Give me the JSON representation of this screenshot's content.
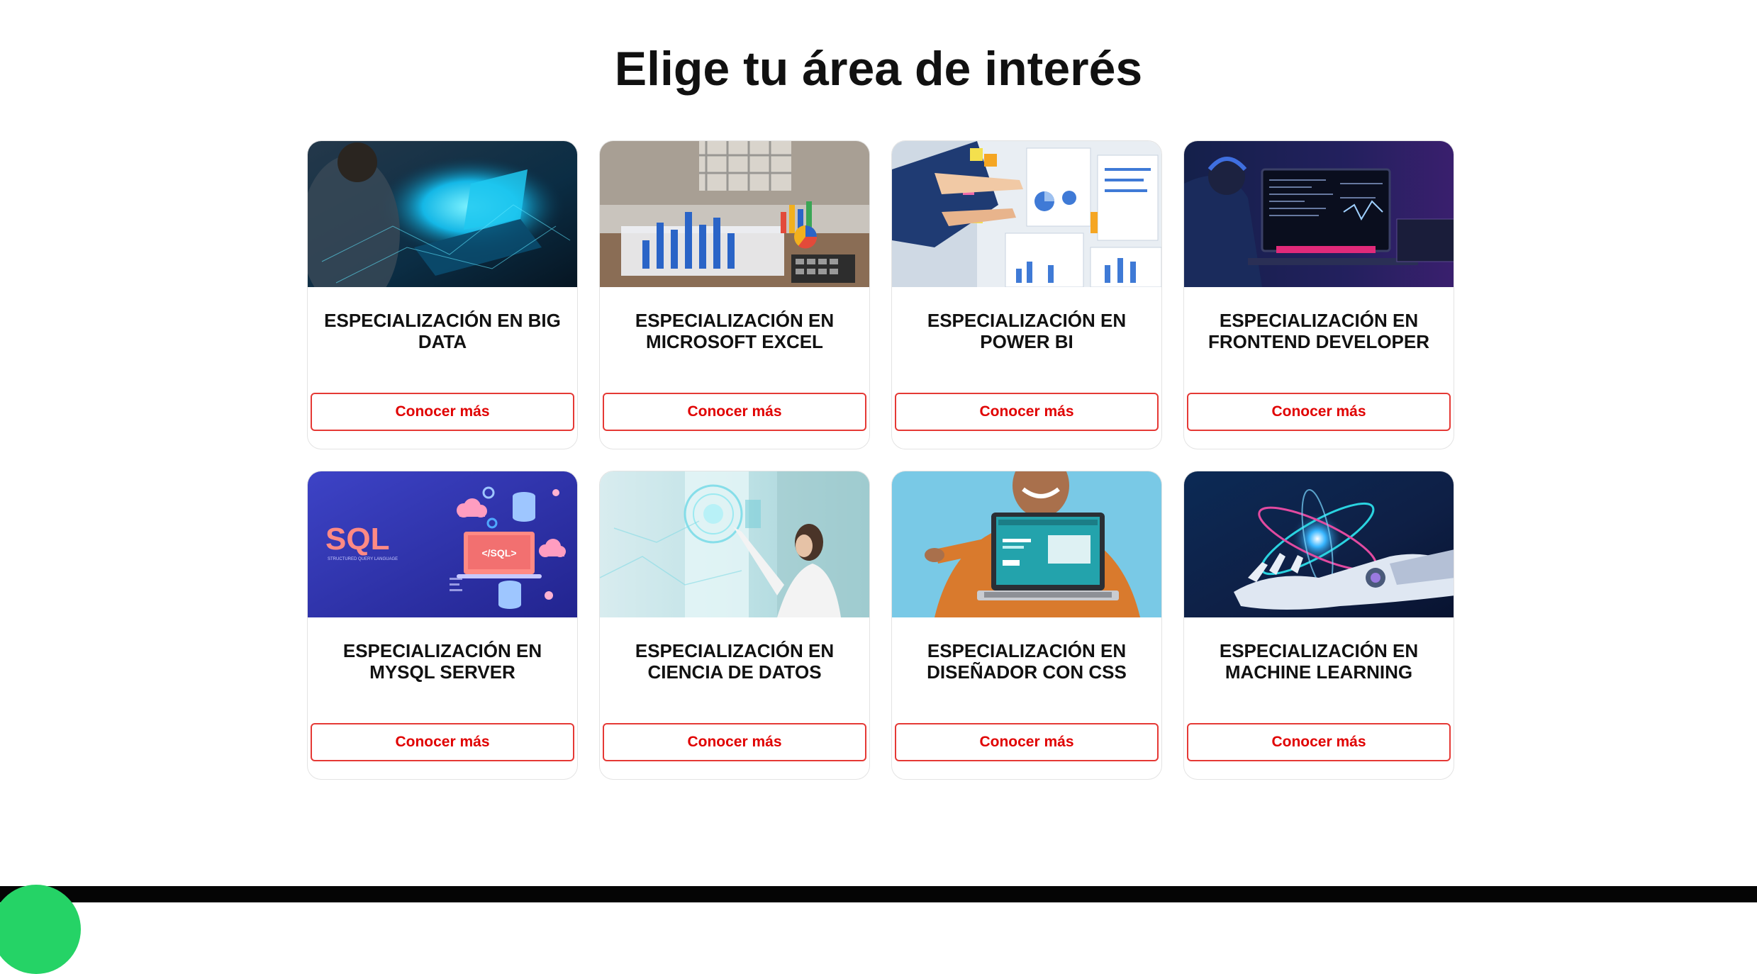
{
  "page": {
    "title": "Elige tu área de interés"
  },
  "cards": [
    {
      "title": "ESPECIALIZACIÓN EN BIG DATA",
      "button": "Conocer más",
      "image": "person-laptop-glowing-data"
    },
    {
      "title": "ESPECIALIZACIÓN EN MICROSOFT EXCEL",
      "button": "Conocer más",
      "image": "hands-with-charts-and-calculator"
    },
    {
      "title": "ESPECIALIZACIÓN EN POWER BI",
      "button": "Conocer más",
      "image": "hands-pointing-at-dashboard-boards"
    },
    {
      "title": "ESPECIALIZACIÓN EN FRONTEND DEVELOPER",
      "button": "Conocer más",
      "image": "developer-with-headphones-monitor"
    },
    {
      "title": "ESPECIALIZACIÓN EN MYSQL SERVER",
      "button": "Conocer más",
      "image": "sql-illustration-databases-clouds",
      "image_text": {
        "logo": "SQL",
        "subtitle": "STRUCTURED QUERY LANGUAGE",
        "tag": "</SQL>"
      }
    },
    {
      "title": "ESPECIALIZACIÓN EN CIENCIA DE DATOS",
      "button": "Conocer más",
      "image": "woman-touching-holographic-screen"
    },
    {
      "title": "ESPECIALIZACIÓN EN DISEÑADOR CON CSS",
      "button": "Conocer más",
      "image": "man-pointing-at-laptop-website"
    },
    {
      "title": "ESPECIALIZACIÓN EN MACHINE LEARNING",
      "button": "Conocer más",
      "image": "robot-hand-with-atom"
    }
  ],
  "colors": {
    "accent": "#e00000",
    "button_border": "#e53935",
    "title": "#111111",
    "footer": "#050505",
    "chat": "#25d366"
  },
  "footer": {
    "chat_icon": "whatsapp-icon"
  }
}
